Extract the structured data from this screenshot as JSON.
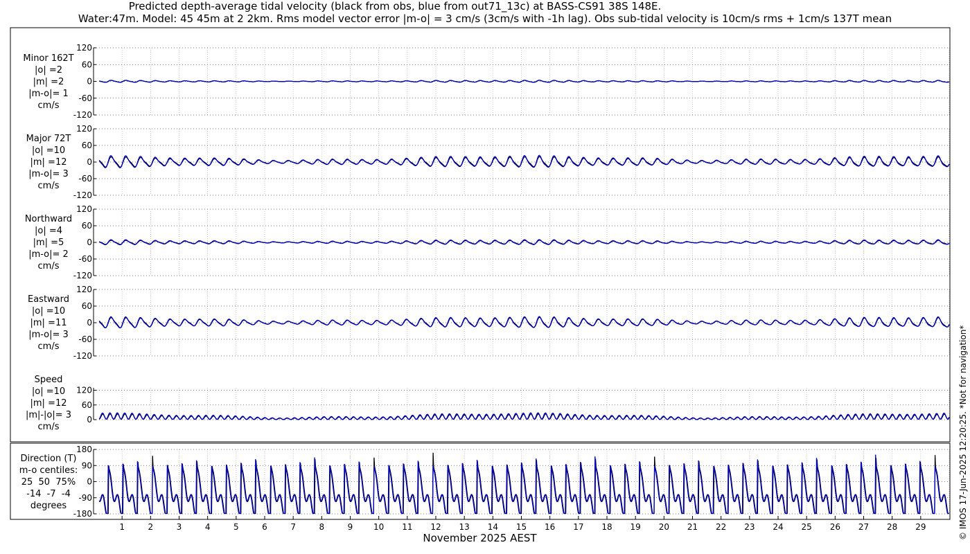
{
  "title_line1": "Predicted depth-average tidal velocity (black from obs, blue from out71_13c) at BASS-CS91 38S 148E.",
  "title_line2": "Water:47m. Model: 45 45m at 2 2km. Rms model vector error |m-o| = 3 cm/s (3cm/s with -1h lag). Obs sub-tidal velocity is 10cm/s rms + 1cm/s 137T mean",
  "copyright": "© IMOS 17-Jun-2025 12:20:25. *Not for navigation*",
  "colors": {
    "obs": "#000000",
    "model": "#0000cc",
    "grid": "#b0b0b0"
  },
  "panels": [
    {
      "label": [
        "Minor 162T",
        "|o| =2",
        "|m| =2",
        "|m-o|= 1",
        "cm/s"
      ]
    },
    {
      "label": [
        "Major 72T",
        "|o| =10",
        "|m| =12",
        "|m-o|= 3",
        "cm/s"
      ]
    },
    {
      "label": [
        "Northward",
        "|o| =4",
        "|m| =5",
        "|m-o|= 2",
        "cm/s"
      ]
    },
    {
      "label": [
        "Eastward",
        "|o| =10",
        "|m| =11",
        "|m-o|= 3",
        "cm/s"
      ]
    },
    {
      "label": [
        "Speed",
        "|o| =10",
        "|m| =12",
        "|m|-|o|= 3",
        "cm/s"
      ]
    },
    {
      "label": [
        "Direction (T)",
        "m-o centiles:",
        "25  50  75%",
        "-14  -7  -4",
        "degrees"
      ]
    }
  ],
  "chart_data": {
    "type": "line",
    "xlabel": "November 2025 AEST",
    "x_ticks": [
      "1",
      "2",
      "3",
      "4",
      "5",
      "6",
      "7",
      "8",
      "9",
      "10",
      "11",
      "12",
      "13",
      "14",
      "15",
      "16",
      "17",
      "18",
      "19",
      "20",
      "21",
      "22",
      "23",
      "24",
      "25",
      "26",
      "27",
      "28",
      "29"
    ],
    "x_range_days": [
      0.0,
      30.0
    ],
    "series_names": [
      "obs",
      "model"
    ],
    "subplots": [
      {
        "name": "Minor 162T",
        "ylim": [
          -120,
          120
        ],
        "yticks": [
          "120",
          "60",
          "0",
          "-60",
          "-120"
        ],
        "amplitude_obs": 2,
        "amplitude_model": 2
      },
      {
        "name": "Major 72T",
        "ylim": [
          -120,
          120
        ],
        "yticks": [
          "120",
          "60",
          "0",
          "-60",
          "-120"
        ],
        "amplitude_obs": 10,
        "amplitude_model": 12
      },
      {
        "name": "Northward",
        "ylim": [
          -120,
          120
        ],
        "yticks": [
          "120",
          "60",
          "0",
          "-60",
          "-120"
        ],
        "amplitude_obs": 4,
        "amplitude_model": 5
      },
      {
        "name": "Eastward",
        "ylim": [
          -120,
          120
        ],
        "yticks": [
          "120",
          "60",
          "0",
          "-60",
          "-120"
        ],
        "amplitude_obs": 10,
        "amplitude_model": 11
      },
      {
        "name": "Speed",
        "ylim": [
          0,
          130
        ],
        "yticks": [
          "120",
          "60",
          "0"
        ],
        "amplitude_obs": 10,
        "amplitude_model": 12
      },
      {
        "name": "Direction (T)",
        "ylim": [
          -180,
          180
        ],
        "yticks": [
          "180",
          "90",
          "0",
          "-90",
          "-180"
        ]
      }
    ]
  }
}
